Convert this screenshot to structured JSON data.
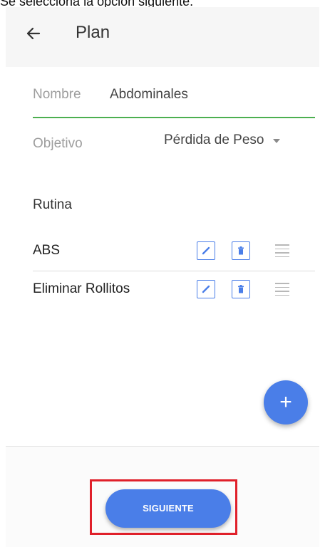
{
  "caption": "Se selecciona la opción siguiente.",
  "appbar": {
    "title": "Plan"
  },
  "form": {
    "name_label": "Nombre",
    "name_value": "Abdominales",
    "objective_label": "Objetivo",
    "objective_value": "Pérdida de Peso"
  },
  "routine": {
    "heading": "Rutina",
    "items": [
      {
        "name": "ABS"
      },
      {
        "name": "Eliminar Rollitos"
      }
    ]
  },
  "fab": {
    "label": "+"
  },
  "footer": {
    "next_label": "SIGUIENTE"
  },
  "colors": {
    "accent": "#4a7ee8",
    "highlight": "#e0202a",
    "underline": "#4caf50"
  }
}
